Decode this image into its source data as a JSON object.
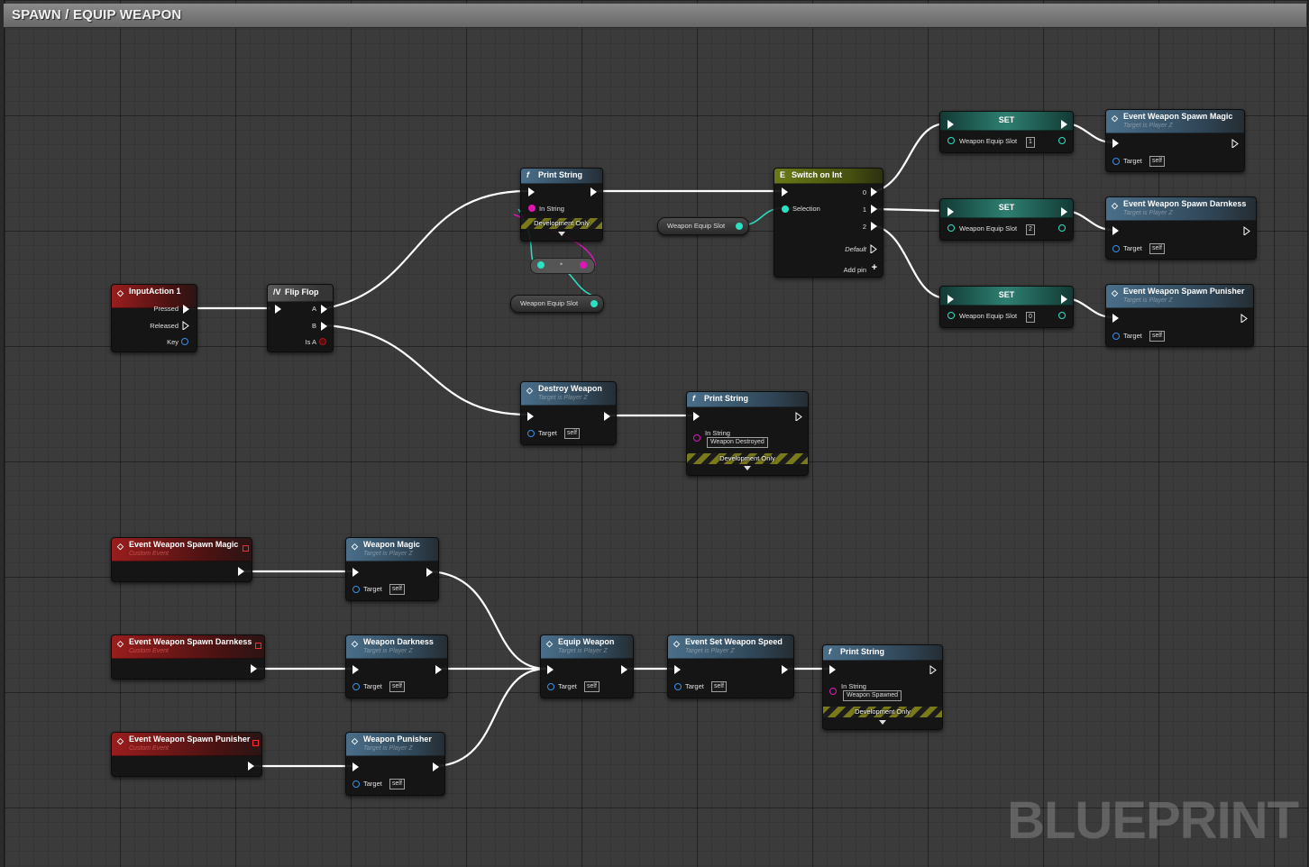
{
  "tab": {
    "title": "SPAWN / EQUIP WEAPON"
  },
  "watermark": "BLUEPRINT",
  "nodes": {
    "input_action": {
      "title": "InputAction 1",
      "pins": [
        "Pressed",
        "Released",
        "Key"
      ]
    },
    "flip_flop": {
      "title": "Flip Flop",
      "pins": [
        "A",
        "B",
        "Is A"
      ]
    },
    "print_string_top": {
      "title": "Print String",
      "pin": "In String",
      "dev": "Development Only"
    },
    "switch_on_int": {
      "title": "Switch on Int",
      "selection": "Selection",
      "outs": [
        "0",
        "1",
        "2"
      ],
      "default": "Default",
      "add_pin": "Add pin"
    },
    "weapon_equip_slot_var_a": {
      "label": "Weapon Equip Slot"
    },
    "weapon_equip_slot_var_b": {
      "label": "Weapon Equip Slot"
    },
    "set_nodes": [
      {
        "title": "SET",
        "pin": "Weapon Equip Slot",
        "value": "1"
      },
      {
        "title": "SET",
        "pin": "Weapon Equip Slot",
        "value": "2"
      },
      {
        "title": "SET",
        "pin": "Weapon Equip Slot",
        "value": "0"
      }
    ],
    "calls_right": [
      {
        "title": "Event Weapon Spawn Magic",
        "subtitle": "Target is Player Z",
        "target": "Target",
        "self": "self"
      },
      {
        "title": "Event Weapon Spawn Darnkess",
        "subtitle": "Target is Player Z",
        "target": "Target",
        "self": "self"
      },
      {
        "title": "Event Weapon Spawn Punisher",
        "subtitle": "Target is Player Z",
        "target": "Target",
        "self": "self"
      }
    ],
    "destroy_weapon": {
      "title": "Destroy Weapon",
      "subtitle": "Target is Player Z",
      "target": "Target",
      "self": "self"
    },
    "print_string_mid": {
      "title": "Print String",
      "pin": "In String",
      "value": "Weapon Destroyed",
      "dev": "Development Only"
    },
    "custom_events": [
      {
        "title": "Event Weapon Spawn Magic",
        "subtitle": "Custom Event"
      },
      {
        "title": "Event Weapon Spawn Darnkess",
        "subtitle": "Custom Event"
      },
      {
        "title": "Event Weapon Spawn Punisher",
        "subtitle": "Custom Event"
      }
    ],
    "weapon_calls": [
      {
        "title": "Weapon Magic",
        "subtitle": "Target is Player Z",
        "target": "Target",
        "self": "self"
      },
      {
        "title": "Weapon Darkness",
        "subtitle": "Target is Player Z",
        "target": "Target",
        "self": "self"
      },
      {
        "title": "Weapon Punisher",
        "subtitle": "Target is Player Z",
        "target": "Target",
        "self": "self"
      }
    ],
    "equip_weapon": {
      "title": "Equip Weapon",
      "subtitle": "Target is Player Z",
      "target": "Target",
      "self": "self"
    },
    "set_weapon_speed": {
      "title": "Event Set Weapon Speed",
      "subtitle": "Target is Player Z",
      "target": "Target",
      "self": "self"
    },
    "print_string_bottom": {
      "title": "Print String",
      "pin": "In String",
      "value": "Weapon Spawned",
      "dev": "Development Only"
    }
  },
  "colors": {
    "exec_wire": "#ffffff",
    "int_wire": "#2ae2c3",
    "string_wire": "#e015b7",
    "event_header": "#9a1d1d",
    "function_header": "#4a6f8a",
    "macro_header": "#6a7a18"
  }
}
